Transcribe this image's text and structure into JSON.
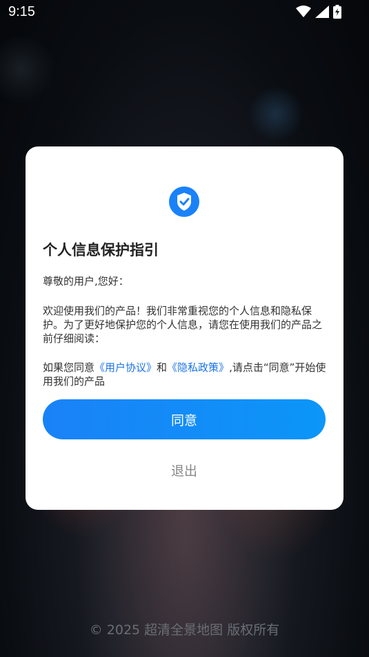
{
  "status_bar": {
    "time": "9:15"
  },
  "dialog": {
    "icon": "shield-check-icon",
    "title": "个人信息保护指引",
    "greeting": "尊敬的用户,您好：",
    "body": "欢迎使用我们的产品！我们非常重视您的个人信息和隐私保护。为了更好地保护您的个人信息，请您在使用我们的产品之前仔细阅读：",
    "consent_prefix": "如果您同意",
    "user_agreement_link": "《用户协议》",
    "and_text": "和",
    "privacy_policy_link": "《隐私政策》",
    "consent_suffix": ",请点击“同意”开始使用我们的产品",
    "agree_label": "同意",
    "exit_label": "退出"
  },
  "footer": {
    "copyright": "© 2025 超清全景地图 版权所有"
  },
  "colors": {
    "accent": "#1a82f7",
    "link": "#1a73e8"
  }
}
